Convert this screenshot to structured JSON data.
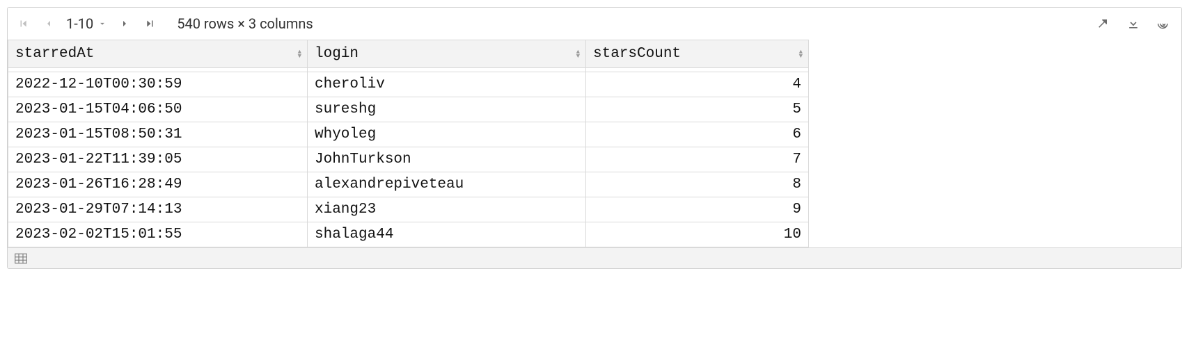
{
  "toolbar": {
    "range_label": "1-10",
    "summary": "540 rows × 3 columns"
  },
  "columns": [
    {
      "key": "starredAt",
      "label": "starredAt",
      "align": "left"
    },
    {
      "key": "login",
      "label": "login",
      "align": "left"
    },
    {
      "key": "starsCount",
      "label": "starsCount",
      "align": "right"
    }
  ],
  "rows": [
    {
      "starredAt": "2022-12-10T00:30:59",
      "login": "cheroliv",
      "starsCount": 4
    },
    {
      "starredAt": "2023-01-15T04:06:50",
      "login": "sureshg",
      "starsCount": 5
    },
    {
      "starredAt": "2023-01-15T08:50:31",
      "login": "whyoleg",
      "starsCount": 6
    },
    {
      "starredAt": "2023-01-22T11:39:05",
      "login": "JohnTurkson",
      "starsCount": 7
    },
    {
      "starredAt": "2023-01-26T16:28:49",
      "login": "alexandrepiveteau",
      "starsCount": 8
    },
    {
      "starredAt": "2023-01-29T07:14:13",
      "login": "xiang23",
      "starsCount": 9
    },
    {
      "starredAt": "2023-02-02T15:01:55",
      "login": "shalaga44",
      "starsCount": 10
    }
  ]
}
